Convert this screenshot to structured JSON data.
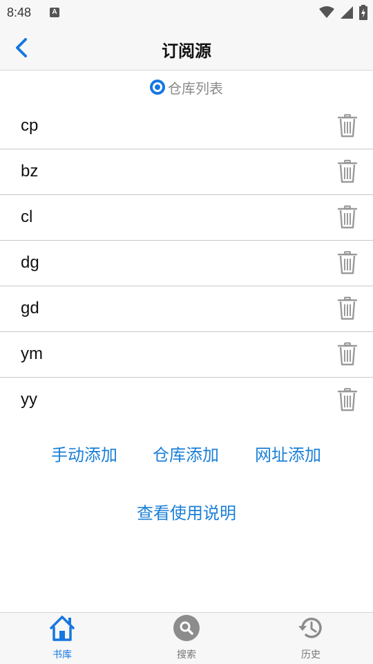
{
  "status_bar": {
    "time": "8:48",
    "notification_letter": "A"
  },
  "header": {
    "title": "订阅源",
    "back_icon": "chevron-left-icon"
  },
  "repo_selector": {
    "label": "仓库列表",
    "selected": true
  },
  "sources": [
    {
      "name": "cp"
    },
    {
      "name": "bz"
    },
    {
      "name": "cl"
    },
    {
      "name": "dg"
    },
    {
      "name": "gd"
    },
    {
      "name": "ym"
    },
    {
      "name": "yy"
    }
  ],
  "actions": {
    "manual_add": "手动添加",
    "repo_add": "仓库添加",
    "url_add": "网址添加",
    "help": "查看使用说明"
  },
  "bottom_nav": {
    "items": [
      {
        "label": "书库",
        "icon": "home-icon",
        "active": true
      },
      {
        "label": "搜索",
        "icon": "search-icon",
        "active": false
      },
      {
        "label": "历史",
        "icon": "history-icon",
        "active": false
      }
    ]
  },
  "colors": {
    "accent": "#1677e0",
    "link": "#1a7fd8",
    "muted": "#8a8a8a"
  }
}
